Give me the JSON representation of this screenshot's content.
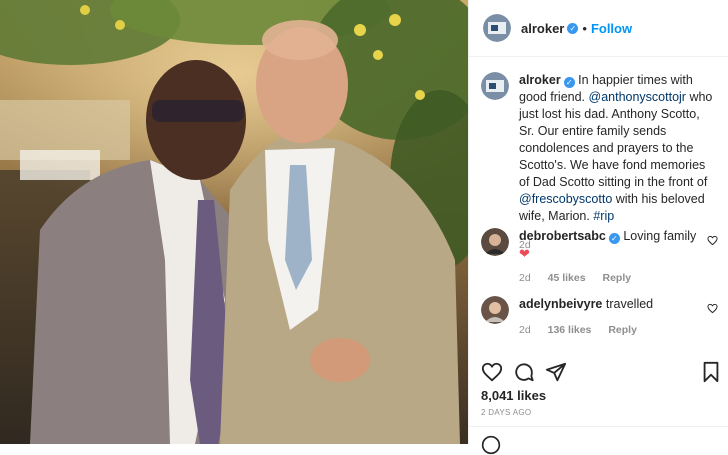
{
  "post": {
    "username": "alroker",
    "follow_label": "Follow",
    "dot": "•"
  },
  "caption": {
    "username": "alroker",
    "text_1": " In happier times with good friend. ",
    "mention_1": "@anthonyscottojr",
    "text_2": " who just lost his dad. Anthony Scotto, Sr. Our entire family sends condolences and prayers to the Scotto's. We have fond memories of Dad Scotto sitting in the front of ",
    "mention_2": "@frescobyscotto",
    "text_3": " with his beloved wife, Marion. ",
    "hashtag": "#rip",
    "age": "2d"
  },
  "comments": [
    {
      "username": "debrobertsabc",
      "text": "Loving family",
      "emoji": "❤",
      "age": "2d",
      "likes": "45 likes",
      "reply": "Reply"
    },
    {
      "username": "adelynbeivyre",
      "text": "travelled",
      "age": "2d",
      "likes": "136 likes",
      "reply": "Reply"
    }
  ],
  "likes": "8,041 likes",
  "post_age": "2 DAYS AGO",
  "colors": {
    "accent": "#0095f6",
    "verified": "#3897f0",
    "heart": "#ed4956"
  },
  "icons": [
    "heart-icon",
    "comment-icon",
    "share-icon",
    "bookmark-icon",
    "verified-icon"
  ]
}
